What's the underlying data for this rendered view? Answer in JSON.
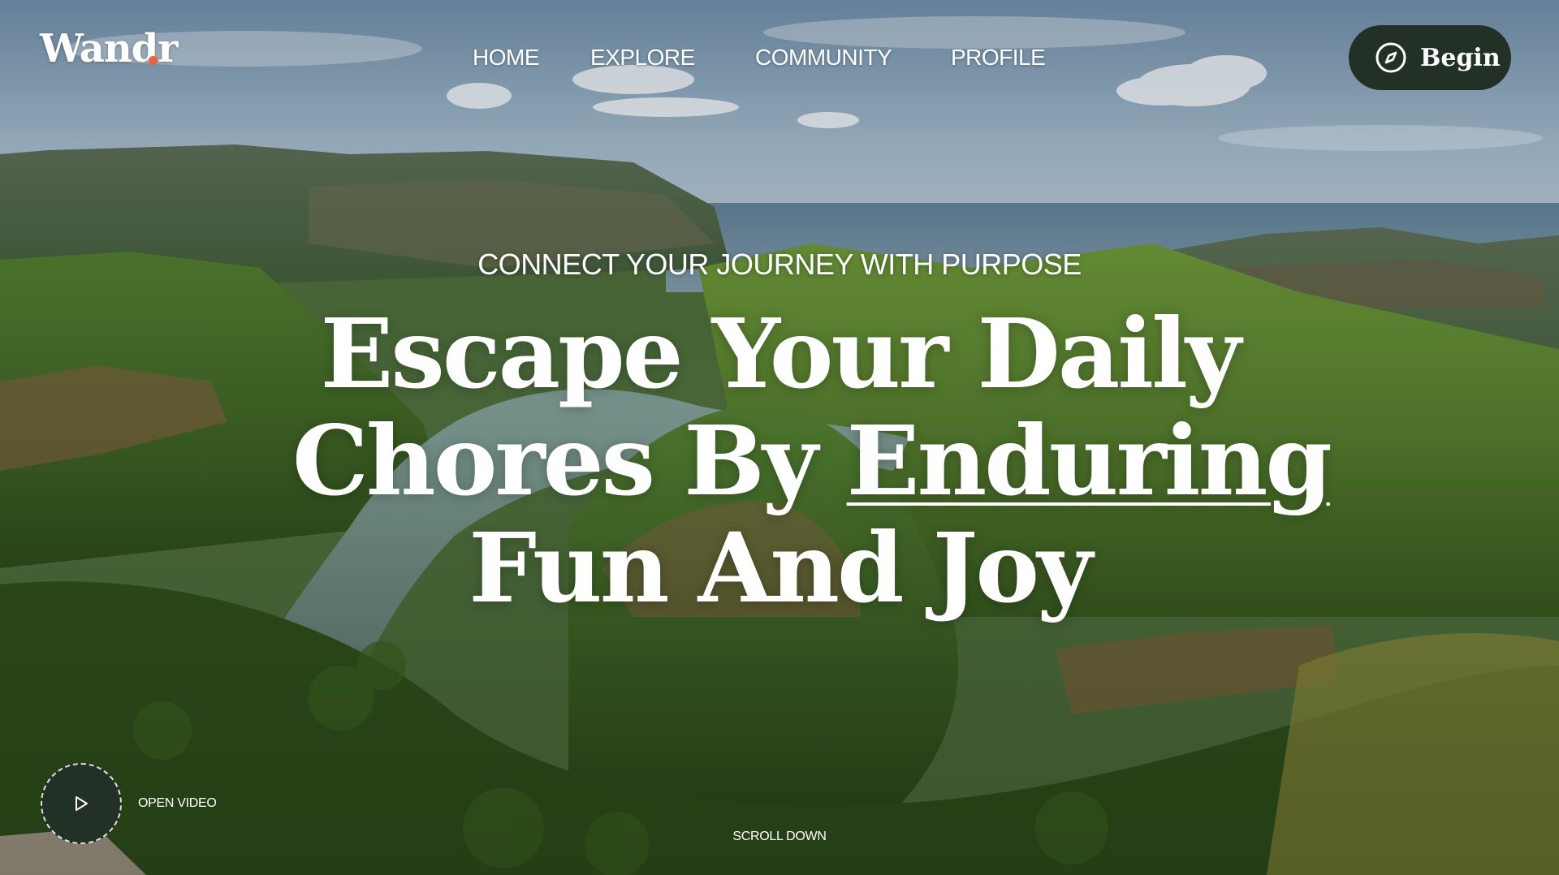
{
  "brand": {
    "name": "Wandr",
    "accent_color": "#e8643c",
    "dark_color": "#233026"
  },
  "nav": {
    "items": [
      {
        "label": "HOME"
      },
      {
        "label": "EXPLORE"
      },
      {
        "label": "COMMUNITY"
      },
      {
        "label": "PROFILE"
      }
    ]
  },
  "header": {
    "cta_label": "Begin",
    "cta_icon": "compass-icon"
  },
  "hero": {
    "eyebrow": "CONNECT YOUR JOURNEY WITH PURPOSE",
    "headline_line1": "Escape Your Daily",
    "headline_line2_start": "Chores By ",
    "headline_line2_emphasis": "Enduring",
    "headline_line3": "Fun And Joy",
    "background_image": "canyon-river-landscape"
  },
  "controls": {
    "video_label": "OPEN VIDEO",
    "video_icon": "play-icon",
    "scroll_label": "SCROLL DOWN"
  }
}
